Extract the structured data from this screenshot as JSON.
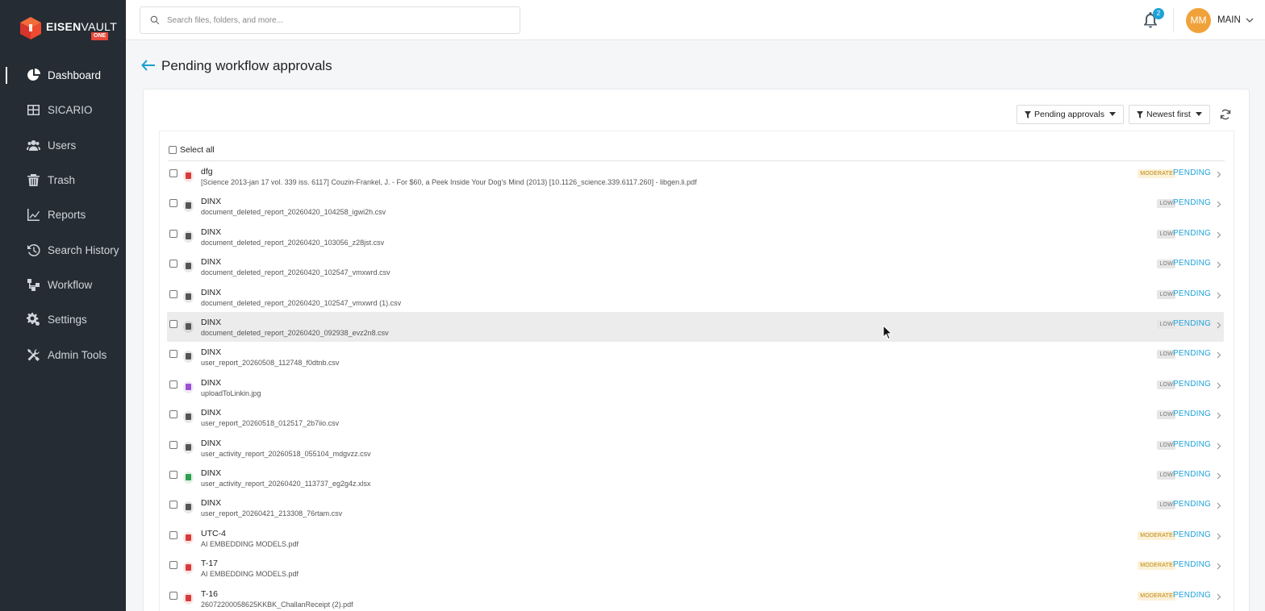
{
  "app": {
    "logo_text_bold": "EISEN",
    "logo_text_light": "VAULT",
    "logo_sub": "ONE"
  },
  "sidebar": {
    "items": [
      {
        "label": "Dashboard",
        "icon": "pie-chart-icon",
        "active": true
      },
      {
        "label": "SICARIO",
        "icon": "grid-icon"
      },
      {
        "label": "Users",
        "icon": "users-icon"
      },
      {
        "label": "Trash",
        "icon": "trash-icon"
      },
      {
        "label": "Reports",
        "icon": "line-chart-icon"
      },
      {
        "label": "Search History",
        "icon": "history-icon"
      },
      {
        "label": "Workflow",
        "icon": "workflow-icon"
      },
      {
        "label": "Settings",
        "icon": "settings-icon"
      },
      {
        "label": "Admin Tools",
        "icon": "tools-icon"
      }
    ]
  },
  "topbar": {
    "search_placeholder": "Search files, folders, and more...",
    "notification_count": "2",
    "avatar_initials": "MM",
    "user_name": "MAIN"
  },
  "page": {
    "title": "Pending workflow approvals"
  },
  "filters": {
    "status": "Pending approvals",
    "sort": "Newest first"
  },
  "list": {
    "select_all_label": "Select all",
    "rows": [
      {
        "title": "dfg",
        "file": "[Science 2013-jan 17 vol. 339 iss. 6117] Couzin-Frankel, J. - For $60, a Peek Inside Your Dog's Mind (2013) [10.1126_science.339.6117.260] - libgen.li.pdf",
        "priority": "MODERATE",
        "status": "PENDING",
        "icon": "pdf-icon",
        "icon_color": "#d93a3a"
      },
      {
        "title": "DINX",
        "file": "document_deleted_report_20260420_104258_igwi2h.csv",
        "priority": "LOW",
        "status": "PENDING",
        "icon": "csv-file-icon",
        "icon_color": "#555555"
      },
      {
        "title": "DINX",
        "file": "document_deleted_report_20260420_103056_z28jst.csv",
        "priority": "LOW",
        "status": "PENDING",
        "icon": "csv-file-icon",
        "icon_color": "#555555"
      },
      {
        "title": "DINX",
        "file": "document_deleted_report_20260420_102547_vmxwrd.csv",
        "priority": "LOW",
        "status": "PENDING",
        "icon": "csv-file-icon",
        "icon_color": "#555555"
      },
      {
        "title": "DINX",
        "file": "document_deleted_report_20260420_102547_vmxwrd (1).csv",
        "priority": "LOW",
        "status": "PENDING",
        "icon": "csv-file-icon",
        "icon_color": "#555555"
      },
      {
        "title": "DINX",
        "file": "document_deleted_report_20260420_092938_evz2n8.csv",
        "priority": "LOW",
        "status": "PENDING",
        "icon": "csv-file-icon",
        "icon_color": "#555555",
        "hover": true
      },
      {
        "title": "DINX",
        "file": "user_report_20260508_112748_f0dtnb.csv",
        "priority": "LOW",
        "status": "PENDING",
        "icon": "csv-file-icon",
        "icon_color": "#555555"
      },
      {
        "title": "DINX",
        "file": "uploadToLinkin.jpg",
        "priority": "LOW",
        "status": "PENDING",
        "icon": "image-file-icon",
        "icon_color": "#9b4fd1"
      },
      {
        "title": "DINX",
        "file": "user_report_20260518_012517_2b7iio.csv",
        "priority": "LOW",
        "status": "PENDING",
        "icon": "csv-file-icon",
        "icon_color": "#555555"
      },
      {
        "title": "DINX",
        "file": "user_activity_report_20260518_055104_mdgvzz.csv",
        "priority": "LOW",
        "status": "PENDING",
        "icon": "csv-file-icon",
        "icon_color": "#555555"
      },
      {
        "title": "DINX",
        "file": "user_activity_report_20260420_113737_eg2g4z.xlsx",
        "priority": "LOW",
        "status": "PENDING",
        "icon": "excel-file-icon",
        "icon_color": "#2e9e4f"
      },
      {
        "title": "DINX",
        "file": "user_report_20260421_213308_76rtam.csv",
        "priority": "LOW",
        "status": "PENDING",
        "icon": "csv-file-icon",
        "icon_color": "#555555"
      },
      {
        "title": "UTC-4",
        "file": "AI EMBEDDING MODELS.pdf",
        "priority": "MODERATE",
        "status": "PENDING",
        "icon": "pdf-icon",
        "icon_color": "#d93a3a"
      },
      {
        "title": "T-17",
        "file": "AI EMBEDDING MODELS.pdf",
        "priority": "MODERATE",
        "status": "PENDING",
        "icon": "pdf-icon",
        "icon_color": "#d93a3a"
      },
      {
        "title": "T-16",
        "file": "26072200058625KKBK_ChallanReceipt (2).pdf",
        "priority": "MODERATE",
        "status": "PENDING",
        "icon": "pdf-icon",
        "icon_color": "#d93a3a"
      }
    ]
  }
}
